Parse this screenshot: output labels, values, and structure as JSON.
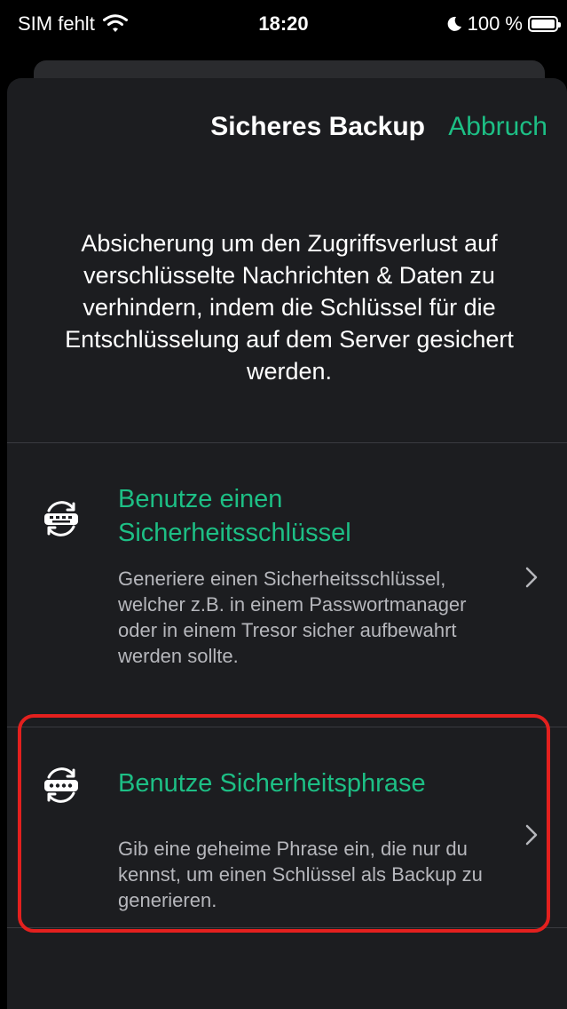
{
  "status_bar": {
    "carrier": "SIM fehlt",
    "time": "18:20",
    "battery": "100 %"
  },
  "nav": {
    "title": "Sicheres Backup",
    "cancel_label": "Abbruch"
  },
  "description": "Absicherung um den Zugriffsverlust auf verschlüsselte Nachrichten & Daten zu verhindern, indem die Schlüssel für die Entschlüsselung auf dem Server gesichert werden.",
  "options": [
    {
      "title": "Benutze einen Sicherheitsschlüssel",
      "description": "Generiere einen Sicherheitsschlüssel, welcher z.B. in einem Passwortmanager oder in einem Tresor sicher aufbewahrt werden sollte.",
      "icon": "security-key-icon"
    },
    {
      "title": "Benutze Sicherheitsphrase",
      "description": "Gib eine geheime Phrase ein, die nur du kennst, um einen Schlüssel als Backup zu generieren.",
      "icon": "security-phrase-icon"
    }
  ],
  "colors": {
    "accent": "#1dbf85",
    "sheet_background": "#1c1d20",
    "highlight": "#e3201e"
  }
}
